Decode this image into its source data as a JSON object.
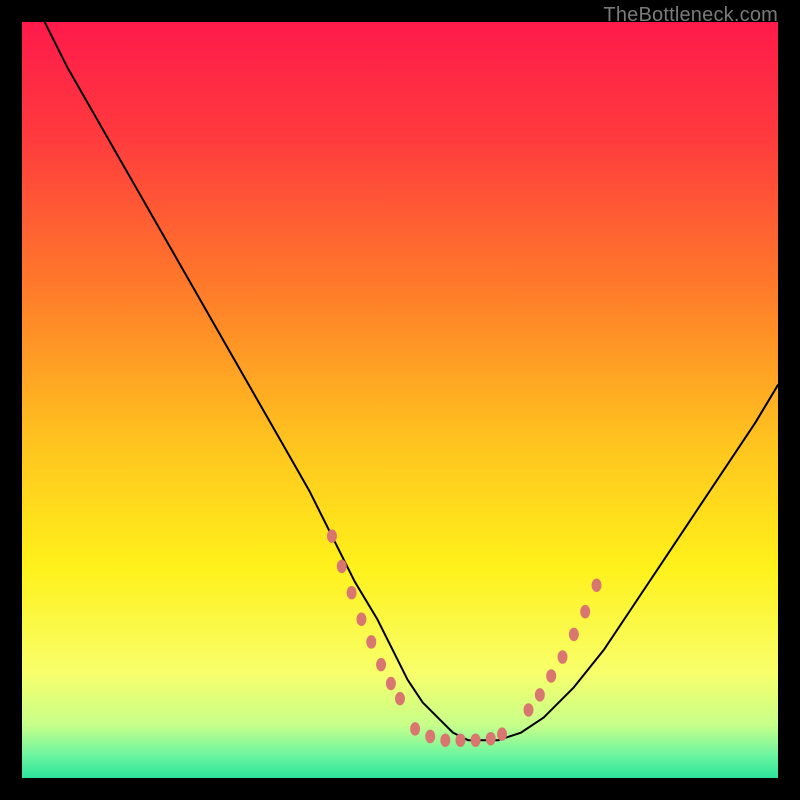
{
  "watermark": "TheBottleneck.com",
  "chart_data": {
    "type": "line",
    "title": "",
    "xlabel": "",
    "ylabel": "",
    "xlim": [
      0,
      100
    ],
    "ylim": [
      0,
      100
    ],
    "grid": false,
    "legend": false,
    "gradient_stops": [
      {
        "offset": 0.0,
        "color": "#ff1a4b"
      },
      {
        "offset": 0.15,
        "color": "#ff3a3e"
      },
      {
        "offset": 0.35,
        "color": "#ff7a2a"
      },
      {
        "offset": 0.55,
        "color": "#ffc21f"
      },
      {
        "offset": 0.72,
        "color": "#fff11a"
      },
      {
        "offset": 0.86,
        "color": "#f8ff6a"
      },
      {
        "offset": 0.93,
        "color": "#c7ff8a"
      },
      {
        "offset": 0.97,
        "color": "#6cf5a0"
      },
      {
        "offset": 1.0,
        "color": "#2be49a"
      }
    ],
    "series": [
      {
        "name": "curve",
        "stroke": "#000000",
        "stroke_width": 2,
        "x": [
          3,
          6,
          10,
          14,
          18,
          22,
          26,
          30,
          34,
          38,
          41,
          44,
          47,
          49,
          51,
          53,
          55,
          57,
          59,
          61,
          63,
          66,
          69,
          73,
          77,
          81,
          85,
          89,
          93,
          97,
          100
        ],
        "y": [
          100,
          94,
          87,
          80,
          73,
          66,
          59,
          52,
          45,
          38,
          32,
          26,
          21,
          17,
          13,
          10,
          8,
          6,
          5,
          5,
          5,
          6,
          8,
          12,
          17,
          23,
          29,
          35,
          41,
          47,
          52
        ]
      },
      {
        "name": "left-dots",
        "type": "scatter",
        "color": "#d8766f",
        "radius": 5,
        "x": [
          41.0,
          42.3,
          43.6,
          44.9,
          46.2,
          47.5,
          48.8,
          50.0
        ],
        "y": [
          32.0,
          28.0,
          24.5,
          21.0,
          18.0,
          15.0,
          12.5,
          10.5
        ]
      },
      {
        "name": "bottom-dots",
        "type": "scatter",
        "color": "#d8766f",
        "radius": 5,
        "x": [
          52,
          54,
          56,
          58,
          60,
          62,
          63.5
        ],
        "y": [
          6.5,
          5.5,
          5.0,
          5.0,
          5.0,
          5.2,
          5.8
        ]
      },
      {
        "name": "right-dots",
        "type": "scatter",
        "color": "#d8766f",
        "radius": 5,
        "x": [
          67.0,
          68.5,
          70.0,
          71.5,
          73.0,
          74.5,
          76.0
        ],
        "y": [
          9.0,
          11.0,
          13.5,
          16.0,
          19.0,
          22.0,
          25.5
        ]
      }
    ]
  }
}
